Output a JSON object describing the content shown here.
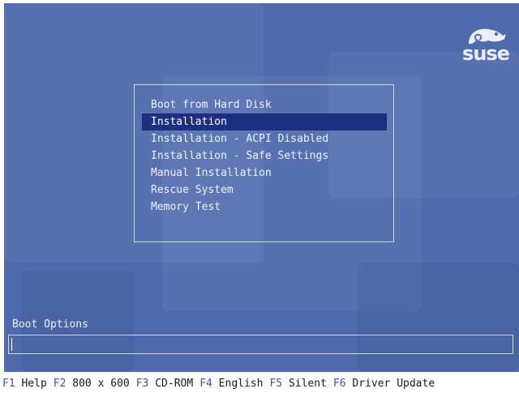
{
  "colors": {
    "background": "#4f6aad",
    "selection": "#1f2f80",
    "fkey_key": "#3d4ec6",
    "fkey_label": "#1a1a1a"
  },
  "logo": {
    "text": "suse",
    "icon": "chameleon-icon"
  },
  "menu": {
    "items": [
      {
        "label": "Boot from Hard Disk",
        "selected": false
      },
      {
        "label": "Installation",
        "selected": true
      },
      {
        "label": "Installation - ACPI Disabled",
        "selected": false
      },
      {
        "label": "Installation - Safe Settings",
        "selected": false
      },
      {
        "label": "Manual Installation",
        "selected": false
      },
      {
        "label": "Rescue System",
        "selected": false
      },
      {
        "label": "Memory Test",
        "selected": false
      }
    ]
  },
  "boot_options": {
    "label": "Boot Options",
    "value": ""
  },
  "function_keys": [
    {
      "key": "F1",
      "label": "Help"
    },
    {
      "key": "F2",
      "label": "800 x 600"
    },
    {
      "key": "F3",
      "label": "CD-ROM"
    },
    {
      "key": "F4",
      "label": "English"
    },
    {
      "key": "F5",
      "label": "Silent"
    },
    {
      "key": "F6",
      "label": "Driver Update"
    }
  ]
}
